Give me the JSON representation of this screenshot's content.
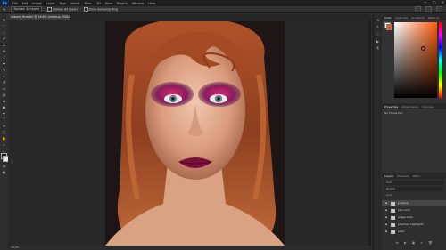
{
  "app": {
    "logo": "Ps",
    "accent": "#31a8ff"
  },
  "menu": [
    "File",
    "Edit",
    "Image",
    "Layer",
    "Type",
    "Select",
    "Filter",
    "3D",
    "View",
    "Plugins",
    "Window",
    "Help"
  ],
  "window_controls": {
    "minimize": "—",
    "maximize": "□",
    "close": "✕"
  },
  "options_bar": {
    "sample_size_label": "Sample: All layers",
    "sample_all_label": "Sample All Layers",
    "show_ring_label": "Show Sampling Ring"
  },
  "document_tab": {
    "title": "redone_thumb4 @ 18.8% (makeup, RGB/16*)"
  },
  "status": {
    "zoom": "18.8%"
  },
  "color_panel": {
    "tabs": [
      "Color",
      "Swatches",
      "Gradients",
      "Patterns"
    ],
    "foreground": "#ffffff",
    "background": "#e85b20"
  },
  "properties_panel": {
    "tabs": [
      "Properties",
      "Adjustments",
      "Libraries"
    ],
    "text": "No Properties"
  },
  "layers_panel": {
    "tabs": [
      "Layers",
      "Channels",
      "Paths"
    ],
    "filter_label": "Kind",
    "blend_label": "Normal",
    "lock_label": "Lock:",
    "layers": [
      {
        "name": "makeup",
        "selected": true
      },
      {
        "name": "hair color"
      },
      {
        "name": "edges lines"
      },
      {
        "name": "shadows highlights"
      },
      {
        "name": "base"
      }
    ],
    "bottom_icons": [
      "fx",
      "◐",
      "▣",
      "+",
      "🗑"
    ]
  },
  "tools": [
    "move-icon",
    "marquee-icon",
    "lasso-icon",
    "quick-select-icon",
    "crop-icon",
    "frame-icon",
    "eyedropper-icon",
    "healing-icon",
    "brush-icon",
    "stamp-icon",
    "history-brush-icon",
    "eraser-icon",
    "gradient-icon",
    "blur-icon",
    "dodge-icon",
    "pen-icon",
    "type-icon",
    "path-select-icon",
    "shape-icon",
    "hand-icon",
    "zoom-icon"
  ]
}
